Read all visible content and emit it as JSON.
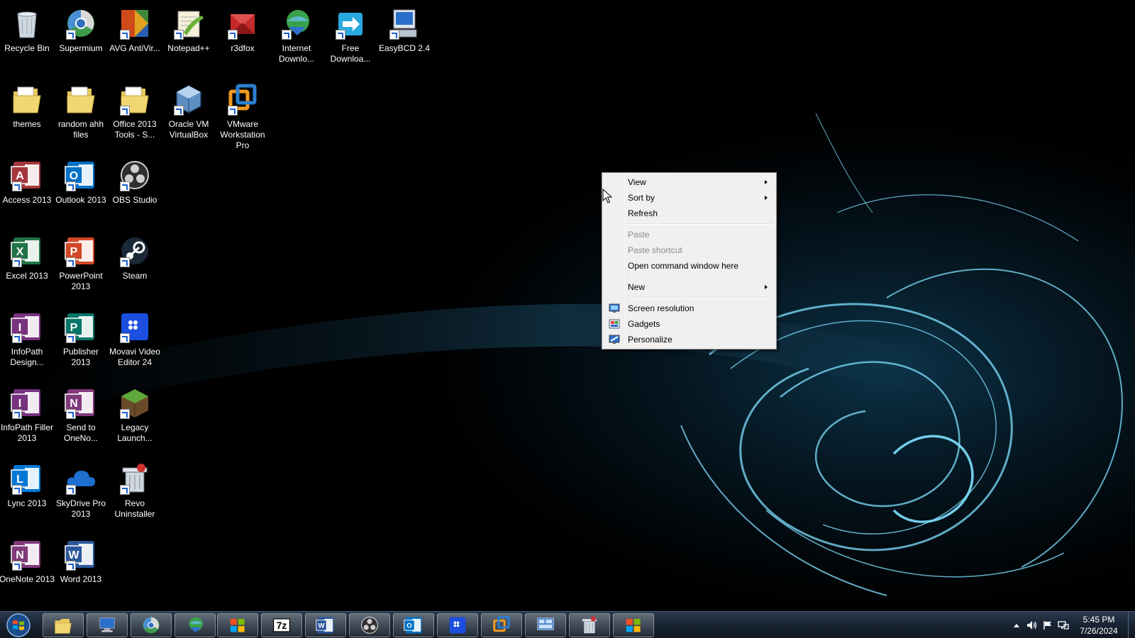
{
  "desktop": {
    "icons": [
      {
        "label": "Recycle Bin",
        "icon": "recycle-bin-icon"
      },
      {
        "label": "Supermium",
        "icon": "supermium-icon"
      },
      {
        "label": "AVG AntiVir...",
        "icon": "avg-antivirus-icon"
      },
      {
        "label": "Notepad++",
        "icon": "notepad-plus-plus-icon"
      },
      {
        "label": "r3dfox",
        "icon": "r3dfox-icon"
      },
      {
        "label": "Internet Downlo...",
        "icon": "internet-download-manager-icon"
      },
      {
        "label": "Free Downloa...",
        "icon": "free-download-manager-icon"
      },
      {
        "label": "EasyBCD 2.4",
        "icon": "easybcd-icon"
      },
      {
        "label": "themes",
        "icon": "folder-icon"
      },
      {
        "label": "random ahh files",
        "icon": "folder-icon"
      },
      {
        "label": "Office 2013 Tools - S...",
        "icon": "folder-icon"
      },
      {
        "label": "Oracle VM VirtualBox",
        "icon": "virtualbox-icon"
      },
      {
        "label": "VMware Workstation Pro",
        "icon": "vmware-icon"
      },
      {
        "label": "Access 2013",
        "icon": "access-icon"
      },
      {
        "label": "Outlook 2013",
        "icon": "outlook-icon"
      },
      {
        "label": "OBS Studio",
        "icon": "obs-icon"
      },
      {
        "label": "Excel 2013",
        "icon": "excel-icon"
      },
      {
        "label": "PowerPoint 2013",
        "icon": "powerpoint-icon"
      },
      {
        "label": "Steam",
        "icon": "steam-icon"
      },
      {
        "label": "InfoPath Design...",
        "icon": "infopath-icon"
      },
      {
        "label": "Publisher 2013",
        "icon": "publisher-icon"
      },
      {
        "label": "Movavi Video Editor 24",
        "icon": "movavi-icon"
      },
      {
        "label": "InfoPath Filler 2013",
        "icon": "infopath-icon"
      },
      {
        "label": "Send to OneNo...",
        "icon": "send-to-onenote-icon"
      },
      {
        "label": "Legacy Launch...",
        "icon": "minecraft-icon"
      },
      {
        "label": "Lync 2013",
        "icon": "lync-icon"
      },
      {
        "label": "SkyDrive Pro 2013",
        "icon": "skydrive-icon"
      },
      {
        "label": "Revo Uninstaller",
        "icon": "revo-uninstaller-icon"
      },
      {
        "label": "OneNote 2013",
        "icon": "onenote-icon"
      },
      {
        "label": "Word 2013",
        "icon": "word-icon"
      }
    ]
  },
  "context_menu": {
    "view": "View",
    "sort_by": "Sort by",
    "refresh": "Refresh",
    "paste": "Paste",
    "paste_shortcut": "Paste shortcut",
    "open_command_window": "Open command window here",
    "new": "New",
    "screen_resolution": "Screen resolution",
    "gadgets": "Gadgets",
    "personalize": "Personalize"
  },
  "taskbar": {
    "pinned": [
      {
        "icon": "file-explorer-icon"
      },
      {
        "icon": "computer-icon"
      },
      {
        "icon": "supermium-icon"
      },
      {
        "icon": "internet-download-manager-icon"
      },
      {
        "icon": "windows-store-icon"
      },
      {
        "icon": "7zip-icon",
        "text": "7z"
      },
      {
        "icon": "word-icon"
      },
      {
        "icon": "obs-icon"
      },
      {
        "icon": "outlook-icon"
      },
      {
        "icon": "movavi-icon"
      },
      {
        "icon": "vmware-icon"
      },
      {
        "icon": "control-panel-icon"
      },
      {
        "icon": "revo-uninstaller-icon"
      },
      {
        "icon": "windows-store-icon"
      }
    ],
    "clock": {
      "time": "5:45 PM",
      "date": "7/26/2024"
    }
  },
  "colors": {
    "menu_bg": "#f0f0f0",
    "menu_disabled": "#8a8a8a",
    "taskbar": "#1a2636",
    "wallpaper_glow": "#7fe0ff"
  }
}
